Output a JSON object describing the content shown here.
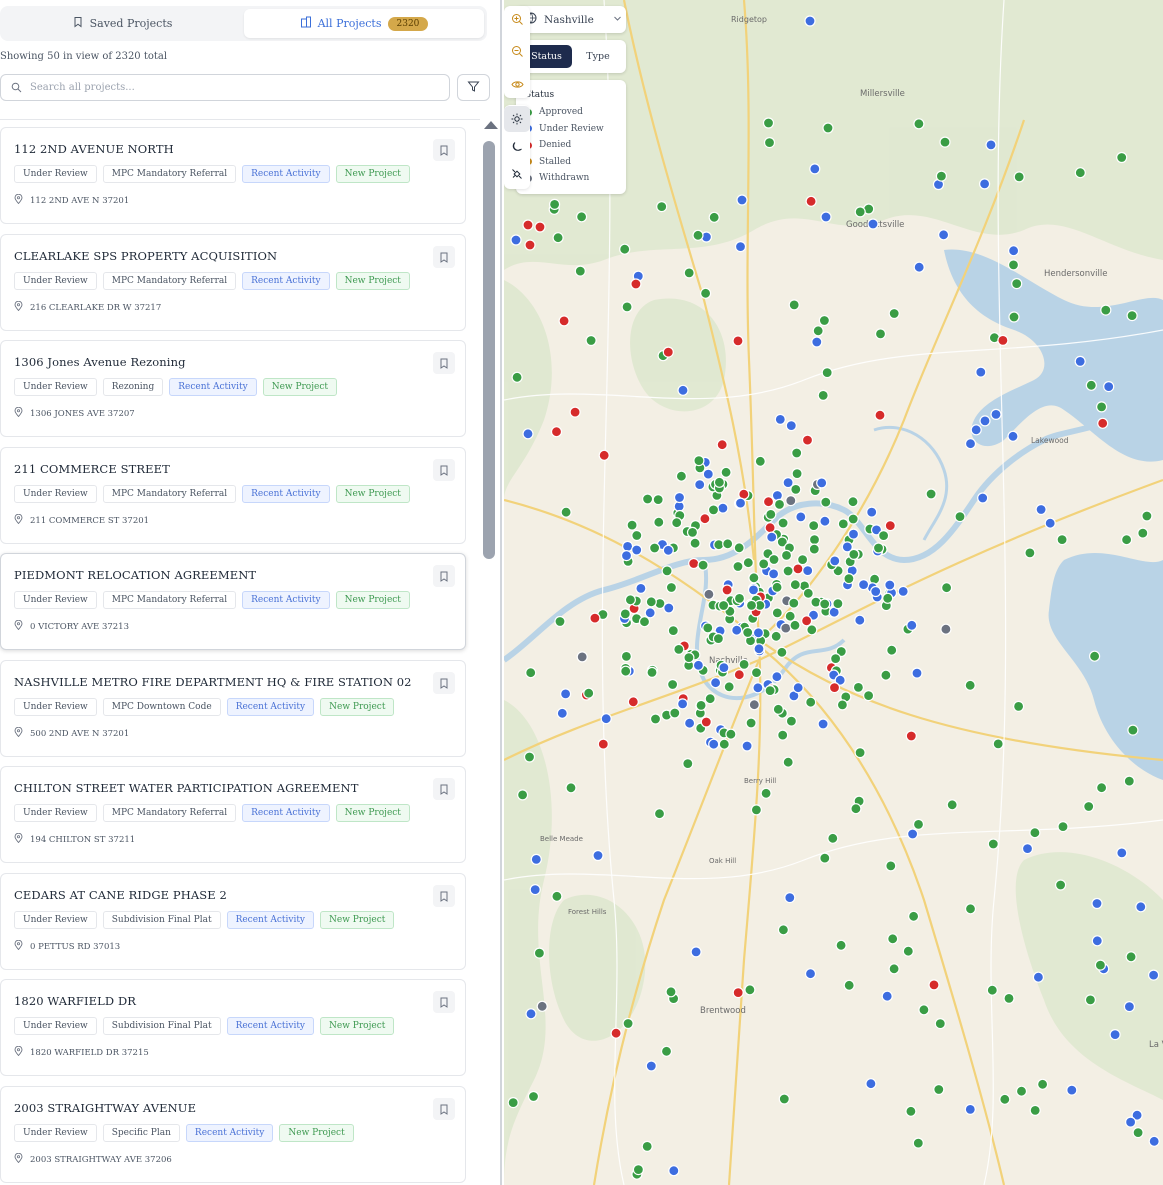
{
  "tabs": {
    "saved_label": "Saved Projects",
    "all_label": "All Projects",
    "all_count": "2320"
  },
  "showing_text": "Showing 50 in view of 2320 total",
  "search": {
    "placeholder": "Search all projects..."
  },
  "projects": [
    {
      "title": "112 2ND AVENUE NORTH",
      "tags": [
        "Under Review",
        "MPC Mandatory Referral",
        "Recent Activity",
        "New Project"
      ],
      "address": "112 2ND AVE N 37201"
    },
    {
      "title": "CLEARLAKE SPS PROPERTY ACQUISITION",
      "tags": [
        "Under Review",
        "MPC Mandatory Referral",
        "Recent Activity",
        "New Project"
      ],
      "address": "216 CLEARLAKE DR W 37217"
    },
    {
      "title": "1306 Jones Avenue Rezoning",
      "tags": [
        "Under Review",
        "Rezoning",
        "Recent Activity",
        "New Project"
      ],
      "address": "1306 JONES AVE 37207"
    },
    {
      "title": "211 COMMERCE STREET",
      "tags": [
        "Under Review",
        "MPC Mandatory Referral",
        "Recent Activity",
        "New Project"
      ],
      "address": "211 COMMERCE ST 37201"
    },
    {
      "title": "PIEDMONT RELOCATION AGREEMENT",
      "tags": [
        "Under Review",
        "MPC Mandatory Referral",
        "Recent Activity",
        "New Project"
      ],
      "address": "0 VICTORY AVE 37213"
    },
    {
      "title": "NASHVILLE METRO FIRE DEPARTMENT HQ & FIRE STATION 02",
      "tags": [
        "Under Review",
        "MPC Downtown Code",
        "Recent Activity",
        "New Project"
      ],
      "address": "500 2ND AVE N 37201"
    },
    {
      "title": "CHILTON STREET WATER PARTICIPATION AGREEMENT",
      "tags": [
        "Under Review",
        "MPC Mandatory Referral",
        "Recent Activity",
        "New Project"
      ],
      "address": "194 CHILTON ST 37211"
    },
    {
      "title": "CEDARS AT CANE RIDGE PHASE 2",
      "tags": [
        "Under Review",
        "Subdivision Final Plat",
        "Recent Activity",
        "New Project"
      ],
      "address": "0 PETTUS RD 37013"
    },
    {
      "title": "1820 WARFIELD DR",
      "tags": [
        "Under Review",
        "Subdivision Final Plat",
        "Recent Activity",
        "New Project"
      ],
      "address": "1820 WARFIELD DR 37215"
    },
    {
      "title": "2003 STRAIGHTWAY AVENUE",
      "tags": [
        "Under Review",
        "Specific Plan",
        "Recent Activity",
        "New Project"
      ],
      "address": "2003 STRAIGHTWAY AVE 37206"
    }
  ],
  "map": {
    "location_label": "Nashville",
    "toggle": {
      "status_label": "Status",
      "type_label": "Type"
    },
    "legend": {
      "title": "Status",
      "items": [
        {
          "label": "Approved",
          "color": "#3a9d45"
        },
        {
          "label": "Under Review",
          "color": "#3d6de0"
        },
        {
          "label": "Denied",
          "color": "#d62b2b"
        },
        {
          "label": "Stalled",
          "color": "#c78a1a"
        },
        {
          "label": "Withdrawn",
          "color": "#6b7280"
        }
      ]
    },
    "place_labels": [
      "Ridgetop",
      "Millersville",
      "Goodlettsville",
      "Hendersonville",
      "Lakewood",
      "Nashville",
      "Berry Hill",
      "Belle Meade",
      "Oak Hill",
      "Forest Hills",
      "Brentwood",
      "La Vergne"
    ],
    "controls": [
      "zoom-in-icon",
      "zoom-out-icon",
      "eye-icon",
      "sun-icon",
      "moon-icon",
      "satellite-icon"
    ]
  }
}
